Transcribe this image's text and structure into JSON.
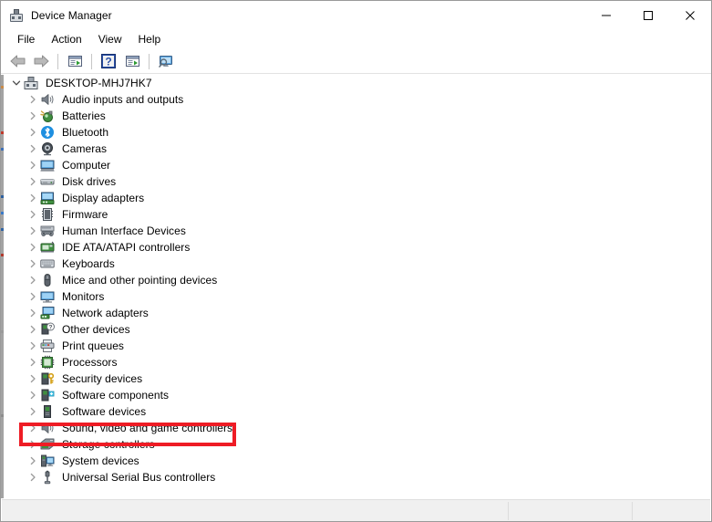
{
  "window": {
    "title": "Device Manager",
    "icon": "device-manager-icon",
    "controls": {
      "minimize": "minimize-button",
      "maximize": "maximize-button",
      "close": "close-button"
    }
  },
  "menubar": {
    "items": [
      {
        "label": "File",
        "name": "menu-file"
      },
      {
        "label": "Action",
        "name": "menu-action"
      },
      {
        "label": "View",
        "name": "menu-view"
      },
      {
        "label": "Help",
        "name": "menu-help"
      }
    ]
  },
  "toolbar": {
    "items": [
      {
        "name": "back-button",
        "icon": "back-arrow-icon"
      },
      {
        "name": "forward-button",
        "icon": "forward-arrow-icon"
      },
      {
        "name": "toolbar-separator-1",
        "icon": "separator"
      },
      {
        "name": "properties-button",
        "icon": "properties-icon"
      },
      {
        "name": "toolbar-separator-2",
        "icon": "separator"
      },
      {
        "name": "help-button",
        "icon": "help-question-icon"
      },
      {
        "name": "update-driver-button",
        "icon": "update-driver-icon"
      },
      {
        "name": "toolbar-separator-3",
        "icon": "separator"
      },
      {
        "name": "scan-hardware-changes-button",
        "icon": "scan-monitor-icon"
      }
    ]
  },
  "tree": {
    "root": {
      "label": "DESKTOP-MHJ7HK7",
      "icon": "computer-root-icon",
      "expanded": true
    },
    "items": [
      {
        "label": "Audio inputs and outputs",
        "icon": "speaker-icon"
      },
      {
        "label": "Batteries",
        "icon": "battery-icon"
      },
      {
        "label": "Bluetooth",
        "icon": "bluetooth-icon"
      },
      {
        "label": "Cameras",
        "icon": "camera-icon"
      },
      {
        "label": "Computer",
        "icon": "computer-icon"
      },
      {
        "label": "Disk drives",
        "icon": "disk-drive-icon"
      },
      {
        "label": "Display adapters",
        "icon": "display-adapter-icon"
      },
      {
        "label": "Firmware",
        "icon": "firmware-icon"
      },
      {
        "label": "Human Interface Devices",
        "icon": "hid-gamepad-icon"
      },
      {
        "label": "IDE ATA/ATAPI controllers",
        "icon": "ide-controller-icon"
      },
      {
        "label": "Keyboards",
        "icon": "keyboard-icon"
      },
      {
        "label": "Mice and other pointing devices",
        "icon": "mouse-icon"
      },
      {
        "label": "Monitors",
        "icon": "monitor-icon"
      },
      {
        "label": "Network adapters",
        "icon": "network-adapter-icon"
      },
      {
        "label": "Other devices",
        "icon": "other-devices-icon"
      },
      {
        "label": "Print queues",
        "icon": "printer-icon"
      },
      {
        "label": "Processors",
        "icon": "processor-chip-icon"
      },
      {
        "label": "Security devices",
        "icon": "security-key-icon"
      },
      {
        "label": "Software components",
        "icon": "software-component-icon"
      },
      {
        "label": "Software devices",
        "icon": "software-device-icon"
      },
      {
        "label": "Sound, video and game controllers",
        "icon": "speaker-icon",
        "highlighted": true
      },
      {
        "label": "Storage controllers",
        "icon": "storage-controller-icon"
      },
      {
        "label": "System devices",
        "icon": "system-device-icon"
      },
      {
        "label": "Universal Serial Bus controllers",
        "icon": "usb-icon"
      }
    ]
  },
  "annotation": {
    "target": "Sound, video and game controllers",
    "color": "#ee1c25",
    "shape": "rectangle"
  },
  "statusbar": {
    "text": ""
  }
}
